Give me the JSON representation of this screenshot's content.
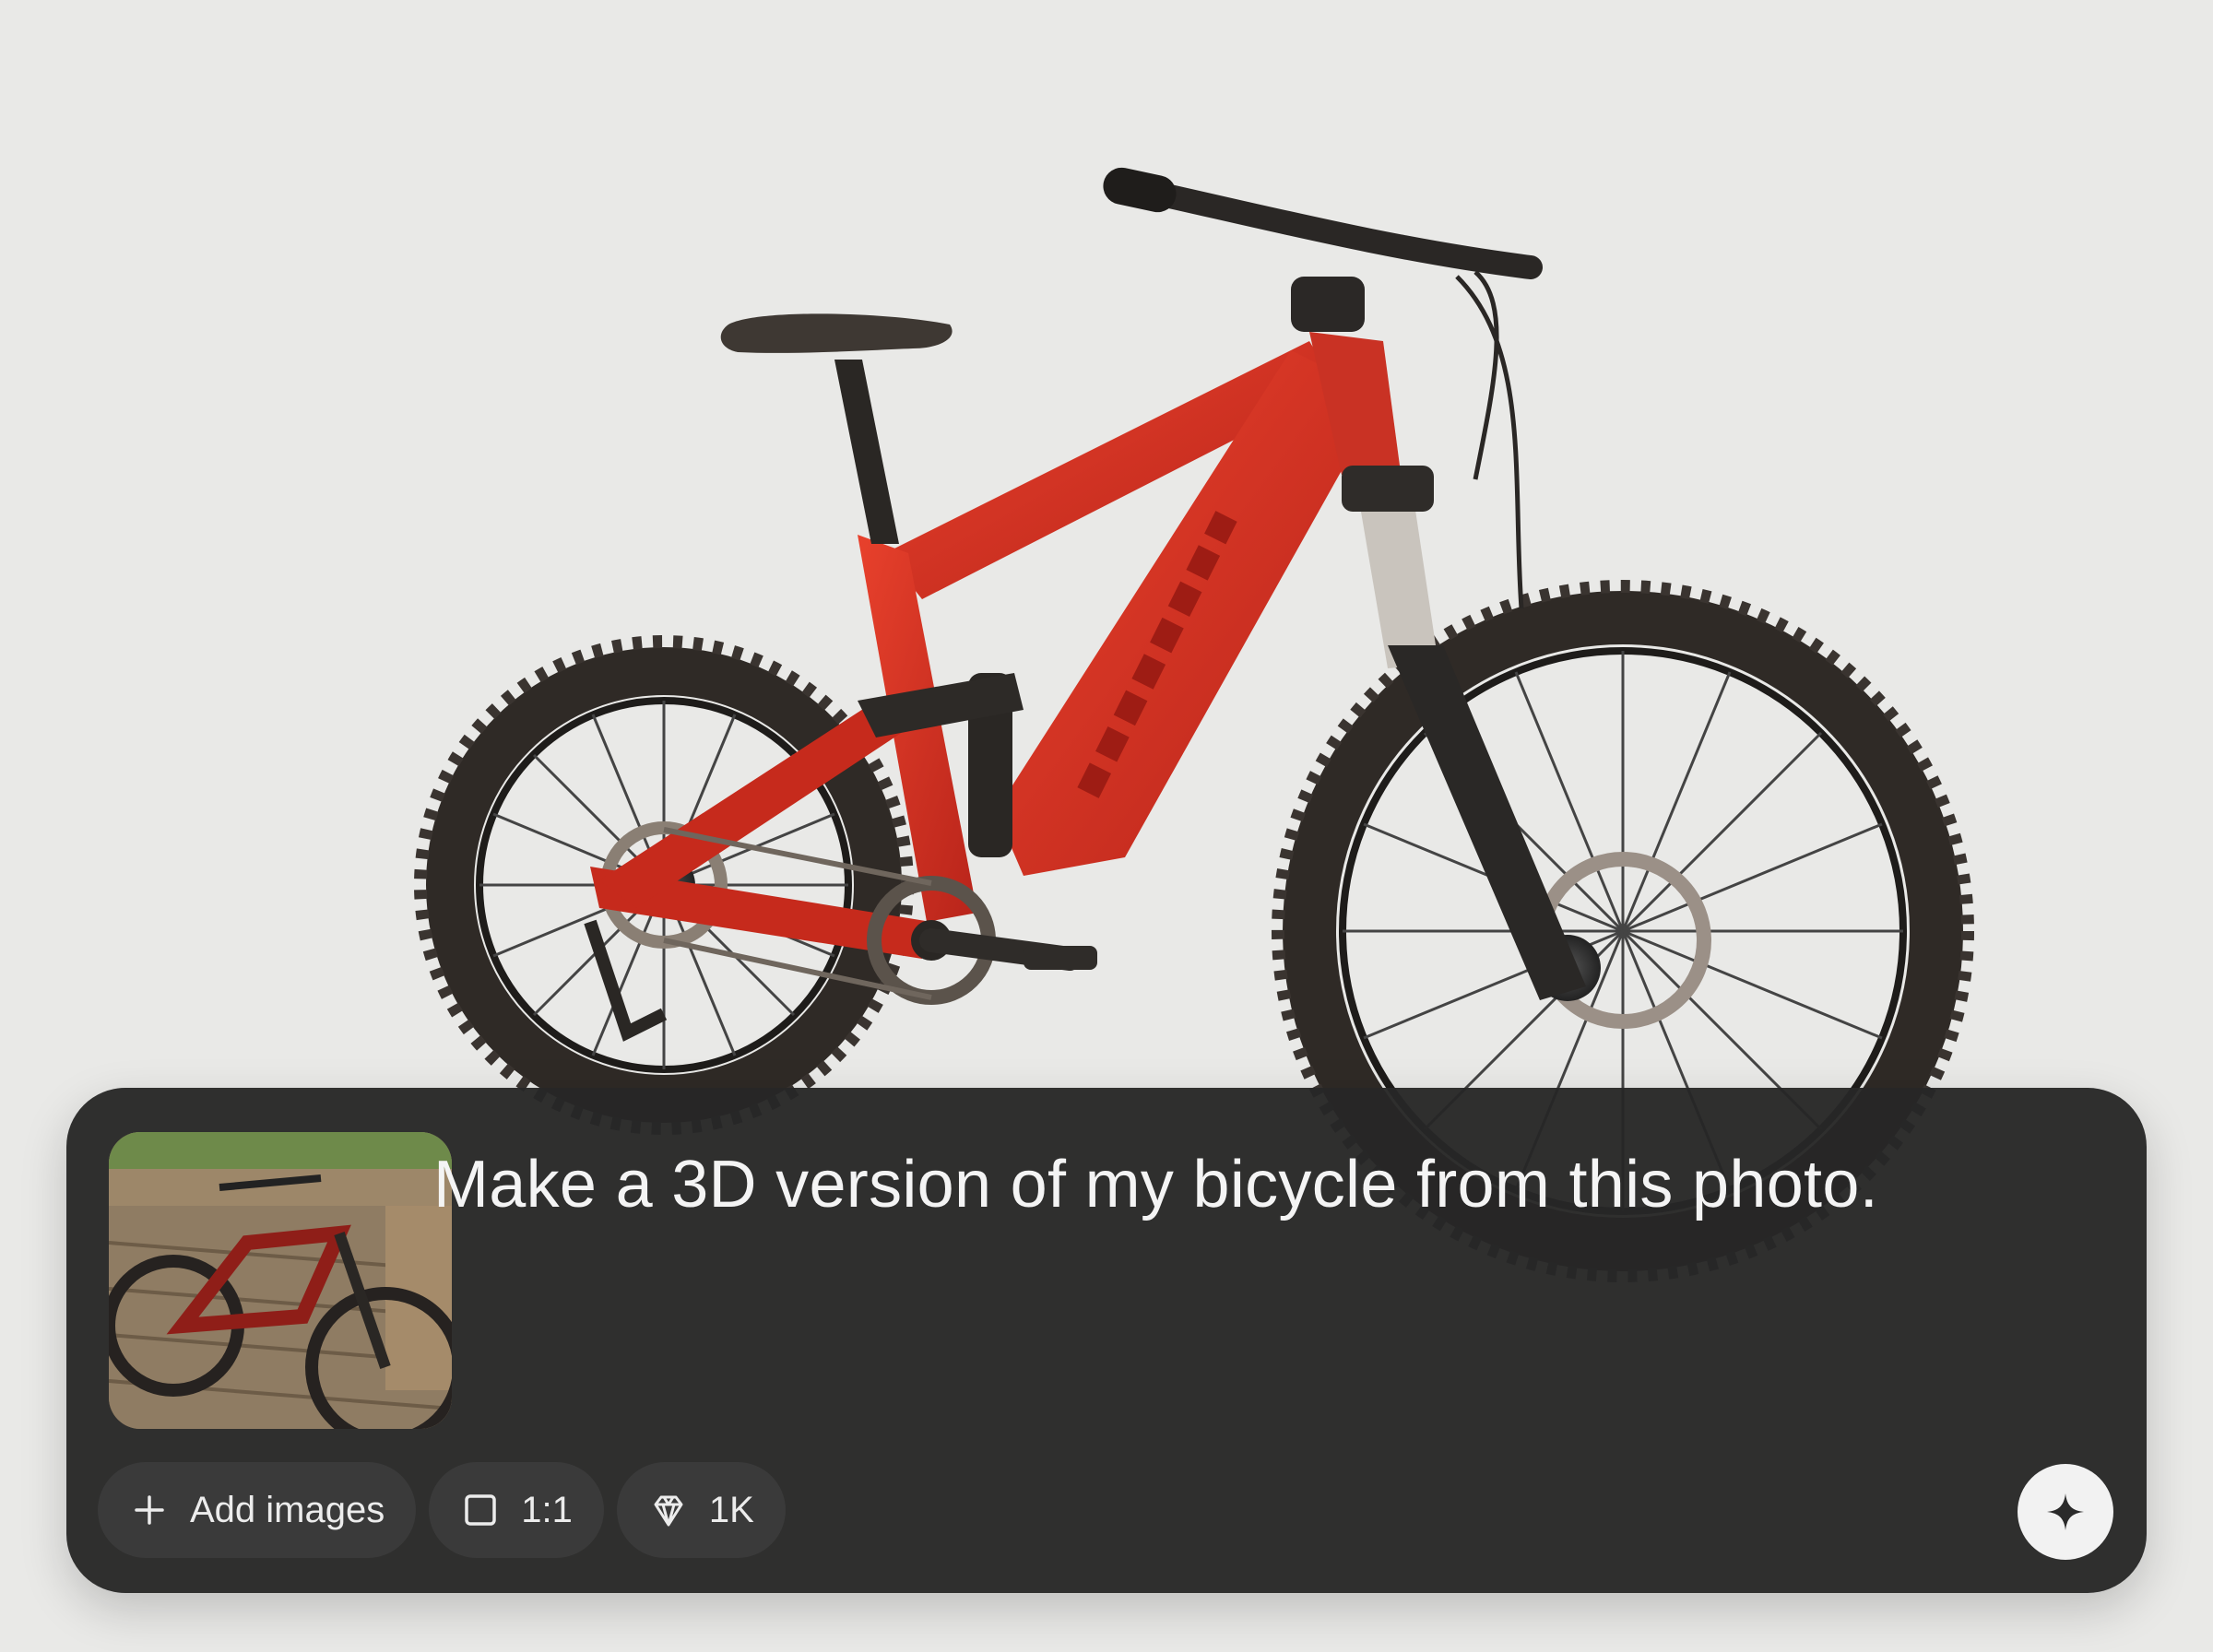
{
  "composer": {
    "prompt": "Make a 3D version of my bicycle from this photo.",
    "toolbar": {
      "add_images_label": "Add images",
      "aspect_ratio_label": "1:1",
      "resolution_label": "1K"
    },
    "icons": {
      "add": "plus-icon",
      "aspect": "square-icon",
      "resolution": "diamond-icon",
      "generate": "sparkle-icon"
    }
  },
  "colors": {
    "background": "#e9e9e7",
    "panel": "#262626",
    "chip": "#3a3a3a",
    "bike_frame": "#d9301f"
  }
}
